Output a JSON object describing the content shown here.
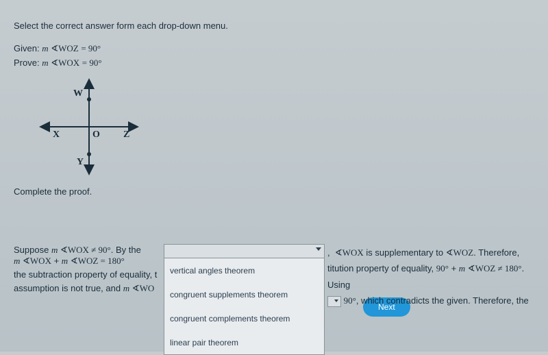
{
  "instruction": "Select the correct answer form each drop-down menu.",
  "given_label": "Given:",
  "given_expr": "m ∢WOZ = 90°",
  "prove_label": "Prove:",
  "prove_expr": "m ∢WOX = 90°",
  "diagram": {
    "W": "W",
    "O": "O",
    "X": "X",
    "Y": "Y",
    "Z": "Z"
  },
  "complete": "Complete the proof.",
  "proof": {
    "line1_left": "Suppose m ∢WOX ≠ 90°. By the",
    "line1_right": ", ∢WOX is supplementary to ∢WOZ. Therefore,",
    "line2_left": "m ∢WOX + m ∢WOZ = 180°",
    "line2_right": "titution property of equality, 90° + m ∢WOZ ≠ 180°. Using",
    "line3_left": "the subtraction property of equality, t",
    "line3_right": " 90°, which contradicts the given. Therefore, the",
    "line4_left": "assumption is not true, and m ∢WO"
  },
  "dropdown_options": [
    "vertical angles theorem",
    "congruent supplements theorem",
    "congruent complements theorem",
    "linear pair theorem"
  ],
  "next_label": "Next"
}
